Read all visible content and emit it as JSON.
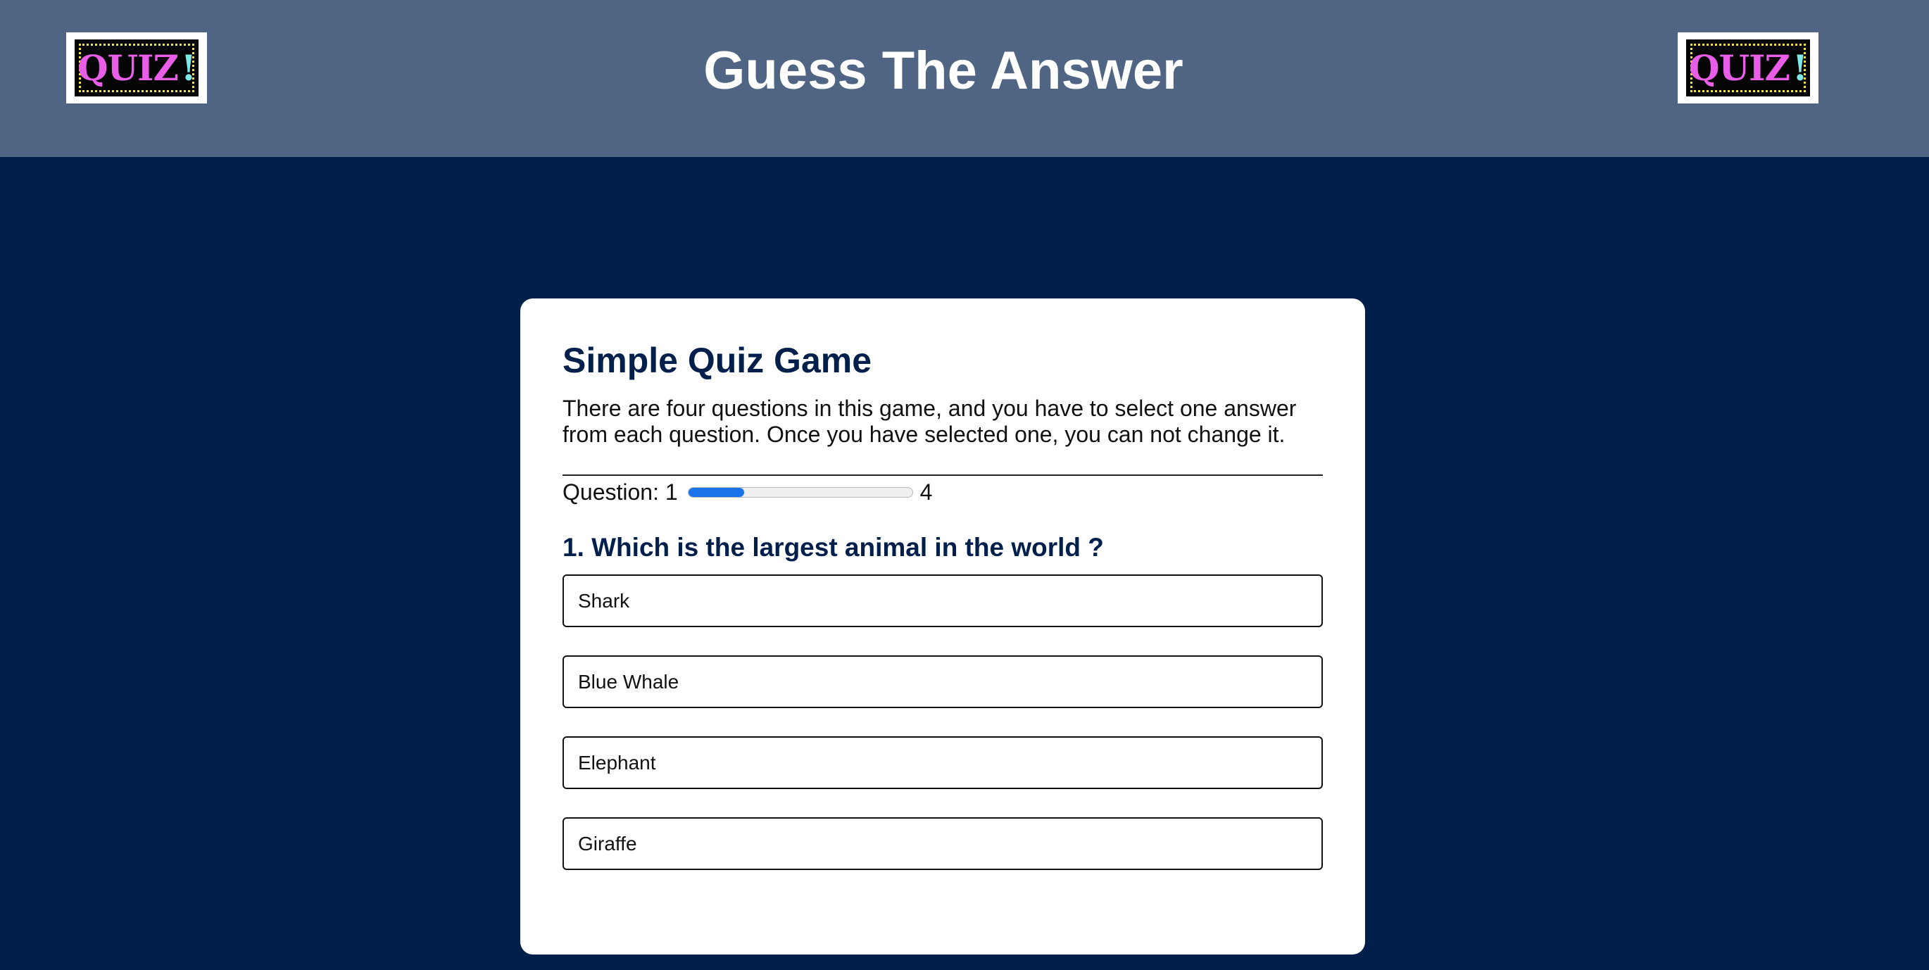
{
  "header": {
    "title": "Guess The Answer",
    "logo_left": {
      "word": "QUIZ",
      "mark": "!"
    },
    "logo_right": {
      "word": "QUIZ",
      "mark": "!"
    }
  },
  "quiz": {
    "title": "Simple Quiz Game",
    "description": "There are four questions in this game, and you have to select one answer from each question. Once you have selected one, you can not change it.",
    "progress": {
      "label": "Question:",
      "current": "1",
      "total": "4",
      "fraction": 0.25
    },
    "question": "1. Which is the largest animal in the world ?",
    "options": [
      "Shark",
      "Blue Whale",
      "Elephant",
      "Giraffe"
    ]
  },
  "colors": {
    "header_bg": "#506583",
    "page_bg": "#011f4b",
    "accent": "#1a73e8",
    "logo_word": "#e85ee6",
    "logo_mark": "#7fe7e6"
  }
}
